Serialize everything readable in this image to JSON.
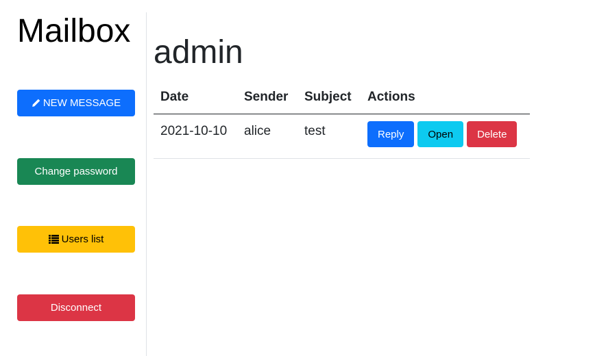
{
  "sidebar": {
    "title": "Mailbox",
    "buttons": {
      "new_message": {
        "label": "NEW MESSAGE",
        "icon": "pencil-icon"
      },
      "change_password": {
        "label": "Change password"
      },
      "users_list": {
        "label": "Users list",
        "icon": "list-icon"
      },
      "disconnect": {
        "label": "Disconnect"
      }
    }
  },
  "main": {
    "title": "admin",
    "table": {
      "headers": [
        "Date",
        "Sender",
        "Subject",
        "Actions"
      ],
      "rows": [
        {
          "date": "2021-10-10",
          "sender": "alice",
          "subject": "test",
          "actions": {
            "reply": "Reply",
            "open": "Open",
            "delete": "Delete"
          }
        }
      ]
    }
  },
  "colors": {
    "primary": "#0d6efd",
    "success": "#198754",
    "warning": "#ffc107",
    "danger": "#dc3545",
    "info": "#0dcaf0"
  }
}
